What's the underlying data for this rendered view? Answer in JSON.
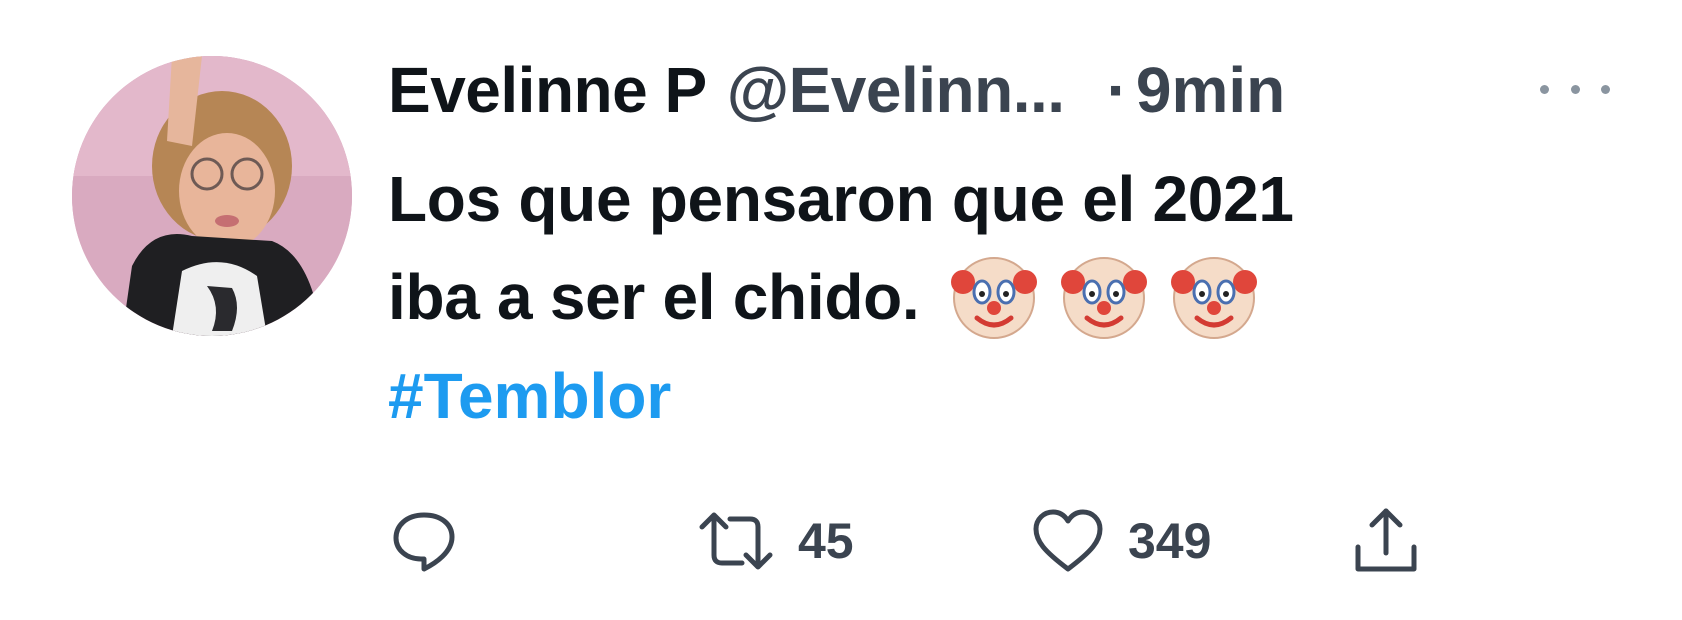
{
  "tweet": {
    "display_name": "Evelinne P",
    "handle": "@Evelinn...",
    "separator": "·",
    "time": "9min",
    "text_line1": "Los que pensaron que el 2021",
    "text_line2": "iba a ser el chido.",
    "emojis": [
      "clown-face",
      "clown-face",
      "clown-face"
    ],
    "hashtag": "#Temblor"
  },
  "actions": {
    "reply_count": "",
    "retweet_count": "45",
    "like_count": "349"
  },
  "colors": {
    "text": "#0f1419",
    "secondary": "#3b4450",
    "link": "#1d9bf0"
  }
}
